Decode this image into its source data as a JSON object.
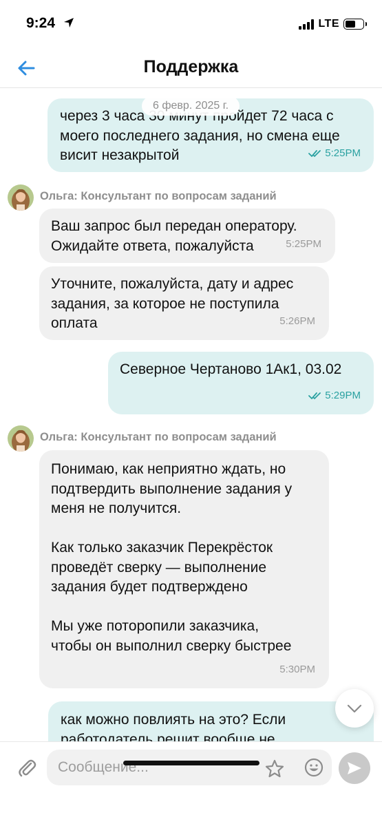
{
  "status_bar": {
    "time": "9:24",
    "network": "LTE",
    "battery_level": 0.6
  },
  "nav": {
    "title": "Поддержка",
    "back_icon": "back-arrow-icon"
  },
  "date_chip": "6 февр. 2025 г.",
  "messages": [
    {
      "direction": "out",
      "text": "через 3 часа 30 минут пройдет 72 часа с\nмоего последнего задания, но смена еще\nвисит незакрытой",
      "time": "5:25PM",
      "status": "read"
    },
    {
      "direction": "in",
      "sender": "Ольга: Консультант по вопросам заданий",
      "text": "Ваш запрос был передан оператору.\nОжидайте ответа, пожалуйста",
      "time": "5:25PM"
    },
    {
      "direction": "in",
      "text": "Уточните, пожалуйста, дату и адрес\nзадания, за которое не поступила\nоплата",
      "time": "5:26PM"
    },
    {
      "direction": "out",
      "text": "Северное Чертаново 1Ак1, 03.02",
      "time": "5:29PM",
      "status": "read"
    },
    {
      "direction": "in",
      "sender": "Ольга: Консультант по вопросам заданий",
      "text": "Понимаю, как неприятно ждать, но\nподтвердить выполнение задания у\nменя не получится.\n\nКак только заказчик Перекрёсток\nпроведёт сверку — выполнение\nзадания будет подтверждено\n\nМы уже потoропили заказчика,\nчтобы он выполнил сверку быстрее",
      "time": "5:30PM"
    },
    {
      "direction": "out",
      "text": "как можно повлиять на это? Если\nработодатель решит вообще не"
    }
  ],
  "composer": {
    "placeholder": "Сообщение..."
  },
  "colors": {
    "accent": "#2e8de0",
    "outgoing_bubble": "#ddf1f1",
    "incoming_bubble": "#f0f0f0",
    "read_ticks": "#2aa1a1"
  }
}
